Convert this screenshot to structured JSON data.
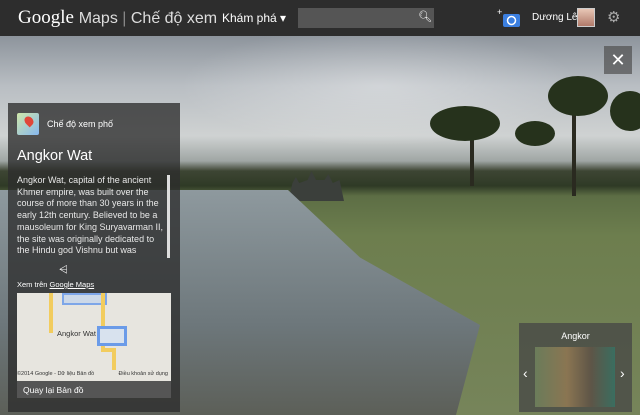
{
  "header": {
    "logo_google": "Google",
    "logo_maps": "Maps",
    "mode": "Chế độ xem",
    "explore": "Khám phá ▾",
    "search_placeholder": "",
    "search_icon": "search-icon",
    "user_name": "Dương Lê"
  },
  "panel": {
    "street_view_label": "Chế độ xem phố",
    "title": "Angkor Wat",
    "description": "Angkor Wat, capital of the ancient Khmer empire, was built over the course of more than 30 years in the early 12th century. Believed to be a mausoleum for King Suryavarman II, the site was originally dedicated to the Hindu god Vishnu but was converted",
    "view_on_prefix": "Xem trên ",
    "view_on_link": "Google Maps",
    "map_place": "Angkor Wat",
    "map_copyright": "©2014 Google - Dữ liệu Bản đồ",
    "map_terms": "Điều khoản sử dụng",
    "back_to_map": "Quay lại Bản đồ"
  },
  "carousel": {
    "title": "Angkor"
  },
  "close": "✕"
}
